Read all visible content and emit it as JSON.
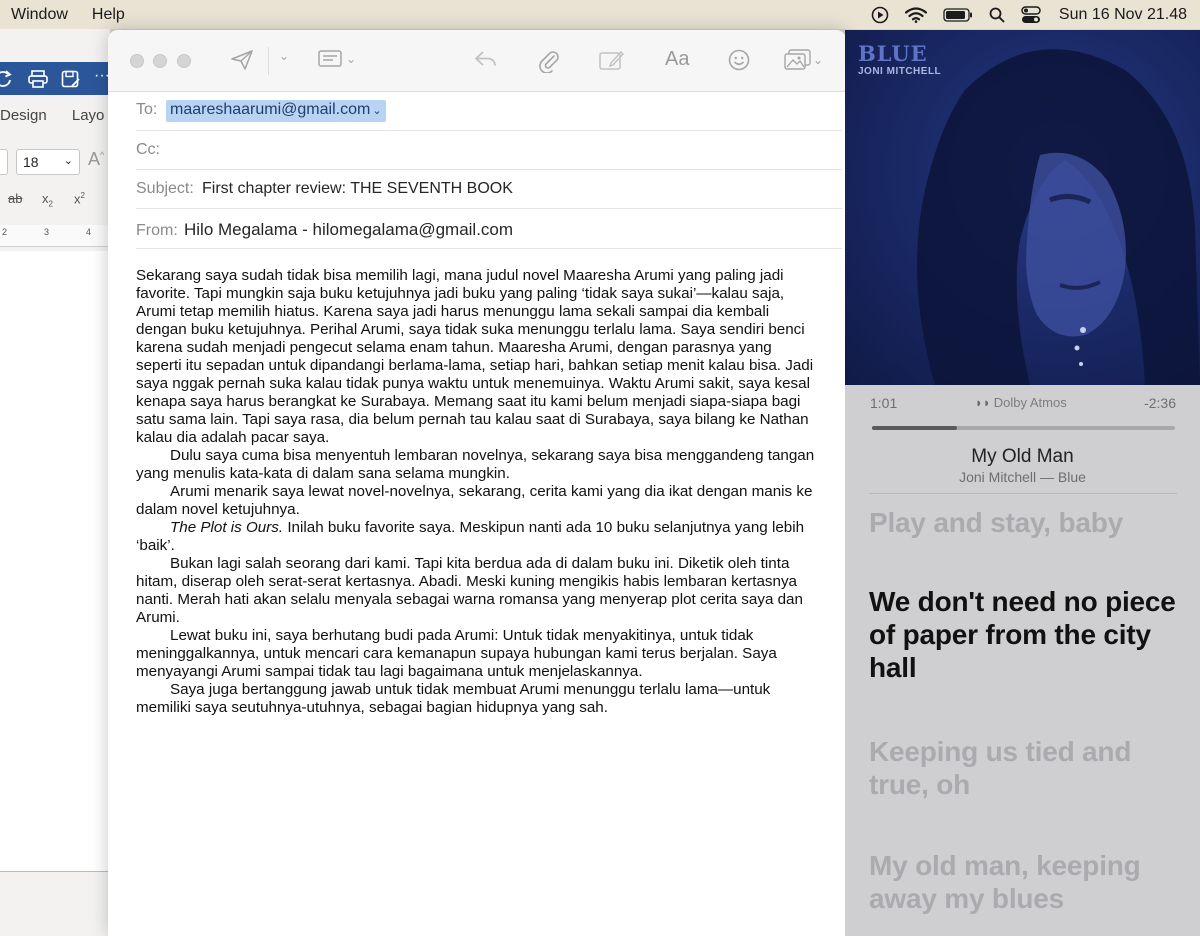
{
  "menubar": {
    "items": [
      "Window",
      "Help"
    ],
    "status_icons": [
      "play-circle-icon",
      "wifi-icon",
      "battery-icon",
      "search-icon",
      "control-center-icon"
    ],
    "clock": "Sun 16 Nov  21.48"
  },
  "word": {
    "tabs": [
      "Design",
      "Layo"
    ],
    "font_size": "18",
    "ruler_marks": [
      "2",
      "3",
      "4"
    ]
  },
  "mail": {
    "to_label": "To:",
    "to_value": "maareshaarumi@gmail.com",
    "cc_label": "Cc:",
    "subject_label": "Subject:",
    "subject_value": "First chapter review: THE SEVENTH BOOK",
    "from_label": "From:",
    "from_value": "Hilo Megalama - hilomegalama@gmail.com",
    "toolbar_font_label": "Aa",
    "body": {
      "p1": "Sekarang saya sudah tidak bisa memilih lagi, mana judul novel Maaresha Arumi yang paling jadi favorite. Tapi mungkin saja buku ketujuhnya jadi buku yang paling ‘tidak saya sukai’—kalau saja, Arumi tetap memilih hiatus. Karena saya jadi harus menunggu lama sekali sampai dia kembali dengan buku ketujuhnya. Perihal Arumi, saya tidak suka menunggu terlalu lama. Saya sendiri benci karena sudah menjadi pengecut selama enam tahun. Maaresha Arumi, dengan parasnya yang seperti itu sepadan untuk dipandangi berlama-lama, setiap hari, bahkan setiap menit kalau bisa. Jadi saya nggak pernah suka kalau tidak punya waktu untuk menemuinya. Waktu Arumi sakit, saya kesal kenapa saya harus berangkat ke Surabaya. Memang saat itu kami belum menjadi siapa-siapa bagi satu sama lain. Tapi saya rasa, dia belum pernah tau kalau saat di Surabaya, saya bilang ke Nathan kalau dia adalah pacar saya.",
      "p2": "Dulu saya cuma bisa menyentuh lembaran novelnya, sekarang saya bisa menggandeng tangan yang menulis kata-kata di dalam sana selama mungkin.",
      "p3": "Arumi menarik saya lewat novel-novelnya, sekarang, cerita kami yang dia ikat dengan manis ke dalam novel ketujuhnya.",
      "p4_em": "The Plot is Ours.",
      "p4_rest": " Inilah buku favorite saya. Meskipun nanti ada 10 buku selanjutnya yang lebih ‘baik’.",
      "p5": "Bukan lagi salah seorang dari kami. Tapi kita berdua ada di dalam buku ini. Diketik oleh tinta hitam, diserap oleh serat-serat kertasnya. Abadi. Meski kuning mengikis habis lembaran kertasnya nanti. Merah hati akan selalu menyala sebagai warna romansa yang menyerap plot cerita saya dan Arumi.",
      "p6": "Lewat buku ini, saya berhutang budi pada Arumi: Untuk tidak menyakitinya, untuk tidak meninggalkannya, untuk mencari cara kemanapun supaya hubungan kami terus berjalan. Saya menyayangi Arumi sampai tidak tau lagi bagaimana untuk menjelaskannya.",
      "p7": "Saya juga bertanggung jawab untuk tidak membuat Arumi menunggu terlalu lama—untuk memiliki saya seutuhnya-utuhnya, sebagai bagian hidupnya yang sah."
    }
  },
  "music": {
    "cover_title": "BLUE",
    "cover_artist": "JONI MITCHELL",
    "elapsed": "1:01",
    "remaining": "-2:36",
    "dolby_mark": "◗◗",
    "dolby_label": "Dolby Atmos",
    "progress_fraction": 0.28,
    "song_title": "My Old Man",
    "song_subtitle": "Joni Mitchell — Blue",
    "lyrics": [
      "Play and stay, baby",
      "We don't need no piece of paper from the city hall",
      "Keeping us tied and true, oh",
      "My old man, keeping away my blues"
    ]
  },
  "colors": {
    "menubar_bg": "#e9e3d4",
    "word_ribbon": "#2b579a",
    "to_chip": "#b9d3f5",
    "cover_bg": "#1b2a68",
    "music_panel": "#cfcfd1"
  }
}
